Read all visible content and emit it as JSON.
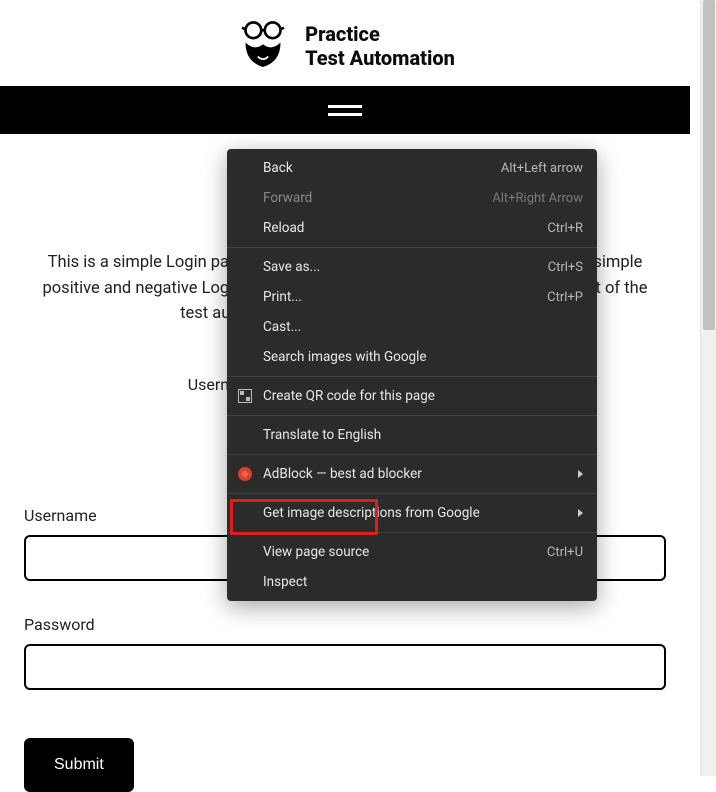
{
  "header": {
    "brand_line1": "Practice",
    "brand_line2": "Test Automation"
  },
  "intro": {
    "text": "This is a simple Login page. Students can use this page to practice writing simple positive and negative LogIn tests. Login functionality is something that most of the test automation engineers need to automate.",
    "credentials_line": "Username: student   Password: Password123"
  },
  "form": {
    "username_label": "Username",
    "password_label": "Password",
    "submit_label": "Submit"
  },
  "context_menu": {
    "items": [
      {
        "label": "Back",
        "accel": "Alt+Left arrow",
        "enabled": true
      },
      {
        "label": "Forward",
        "accel": "Alt+Right Arrow",
        "enabled": false
      },
      {
        "label": "Reload",
        "accel": "Ctrl+R",
        "enabled": true
      }
    ],
    "group2": [
      {
        "label": "Save as...",
        "accel": "Ctrl+S"
      },
      {
        "label": "Print...",
        "accel": "Ctrl+P"
      },
      {
        "label": "Cast..."
      },
      {
        "label": "Search images with Google"
      }
    ],
    "qr": {
      "label": "Create QR code for this page"
    },
    "translate": {
      "label": "Translate to English"
    },
    "adblock": {
      "label": "AdBlock — best ad blocker"
    },
    "imgdesc": {
      "label": "Get image descriptions from Google"
    },
    "source": {
      "label": "View page source",
      "accel": "Ctrl+U"
    },
    "inspect": {
      "label": "Inspect"
    }
  }
}
